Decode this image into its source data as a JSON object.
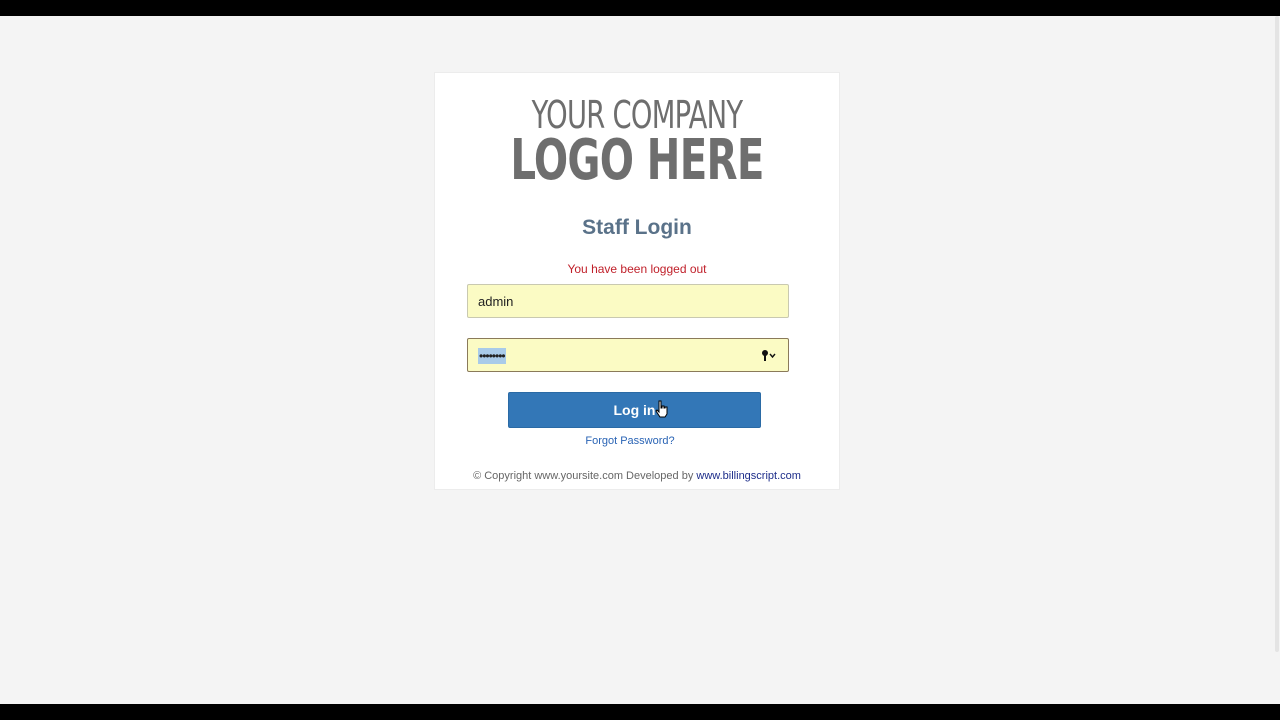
{
  "logo": {
    "line1": "YOUR COMPANY",
    "line2": "LOGO HERE"
  },
  "login": {
    "title": "Staff Login",
    "message": "You have been logged out",
    "username_value": "admin",
    "password_masked": "••••••••",
    "button_label": "Log in",
    "forgot_label": "Forgot Password?"
  },
  "footer": {
    "copyright_text": "© Copyright www.yoursite.com Developed by",
    "developer_link": "www.billingscript.com"
  },
  "icons": {
    "password_manager": "key-icon",
    "cursor": "hand-pointer-cursor"
  },
  "colors": {
    "button_bg": "#3377b7",
    "message_red": "#c0202a",
    "field_autofill_bg": "#fbfbc4",
    "title_color": "#5a7289"
  }
}
